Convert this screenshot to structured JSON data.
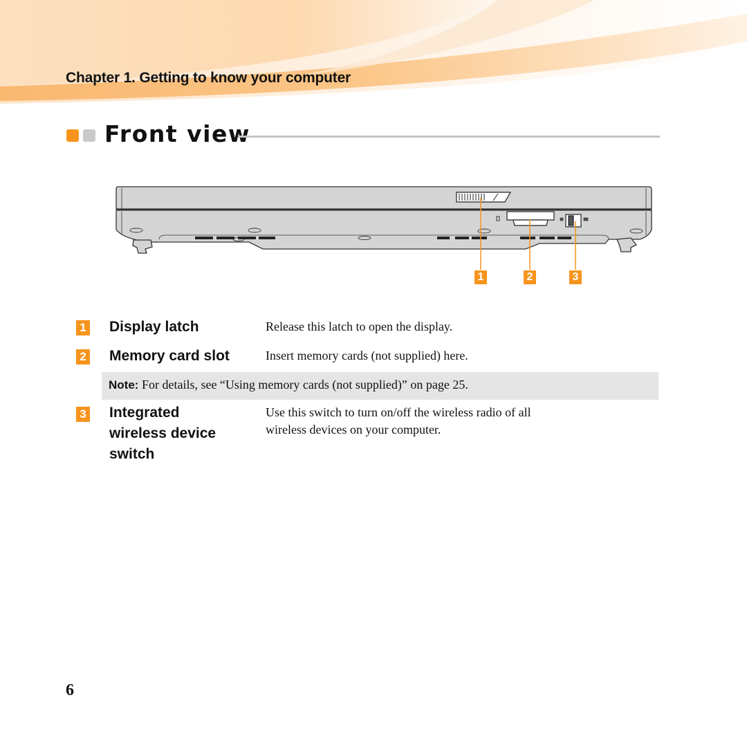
{
  "header": {
    "chapter_title": "Chapter 1. Getting to know your computer"
  },
  "section": {
    "title": "Front view"
  },
  "figure": {
    "description": "Front view of laptop with callouts",
    "callouts": [
      "1",
      "2",
      "3"
    ]
  },
  "items": [
    {
      "number": "1",
      "label": "Display latch",
      "description": "Release this latch to open the display."
    },
    {
      "number": "2",
      "label": "Memory card slot",
      "description": "Insert memory cards (not supplied) here."
    },
    {
      "number": "3",
      "label_lines": [
        "Integrated",
        "wireless device",
        "switch"
      ],
      "description_lines": [
        "Use this switch to turn on/off the wireless radio of all",
        "wireless devices on your computer."
      ]
    }
  ],
  "note": {
    "label": "Note:",
    "text": " For details, see “Using memory cards (not supplied)” on page 25."
  },
  "footer": {
    "page_number": "6"
  },
  "colors": {
    "accent_orange": "#f7941d",
    "accent_gray": "#c7c9cb",
    "note_background": "#e5e5e5"
  }
}
